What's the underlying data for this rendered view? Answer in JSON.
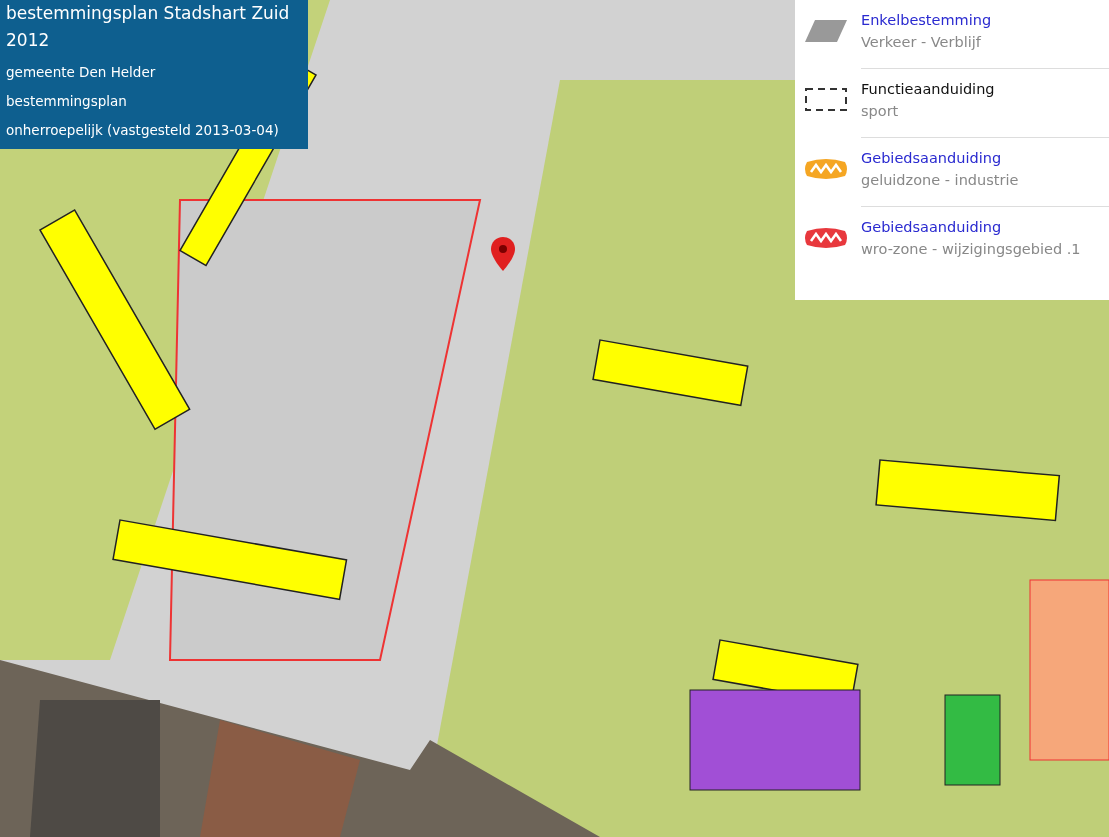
{
  "plan_info": {
    "title": "bestemmingsplan Stadshart Zuid 2012",
    "lines": [
      "gemeente Den Helder",
      "bestemmingsplan",
      "onherroepelijk (vastgesteld 2013-03-04)"
    ]
  },
  "legend": {
    "items": [
      {
        "kind": "area",
        "title": "Enkelbestemming",
        "title_link": true,
        "subtitle": "Verkeer - Verblijf"
      },
      {
        "kind": "dashed",
        "title": "Functieaanduiding",
        "title_link": false,
        "subtitle": "sport"
      },
      {
        "kind": "zone",
        "title": "Gebiedsaanduiding",
        "title_link": true,
        "subtitle": "geluidzone - industrie",
        "color": "#f5a623"
      },
      {
        "kind": "zone",
        "title": "Gebiedsaanduiding",
        "title_link": true,
        "subtitle": "wro-zone - wijzigingsgebied .1",
        "color": "#e8383d"
      }
    ]
  }
}
